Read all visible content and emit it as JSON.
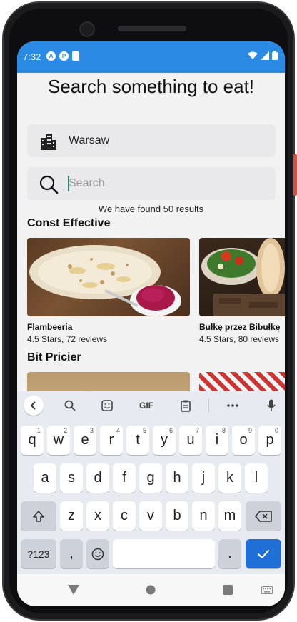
{
  "status_bar": {
    "time": "7:32",
    "left_icons": [
      "A",
      "P",
      "sd-card-icon"
    ]
  },
  "app": {
    "title": "Search something to eat!",
    "city": "Warsaw",
    "search": {
      "placeholder": "Search",
      "value": ""
    },
    "result_text": "We have found 50 results"
  },
  "sections": [
    {
      "title": "Const Effective",
      "restaurants": [
        {
          "name": "Flambeeria",
          "meta": "4.5 Stars, 72 reviews"
        },
        {
          "name": "Bułkę przez Bibułkę",
          "meta": "4.5 Stars, 80 reviews"
        }
      ]
    },
    {
      "title": "Bit Pricier",
      "restaurants": [
        {
          "name": "",
          "meta": ""
        },
        {
          "name": "",
          "meta": ""
        }
      ]
    }
  ],
  "keyboard": {
    "toolbar": {
      "gif_label": "GIF"
    },
    "row1": [
      {
        "label": "q",
        "hint": "1"
      },
      {
        "label": "w",
        "hint": "2"
      },
      {
        "label": "e",
        "hint": "3"
      },
      {
        "label": "r",
        "hint": "4"
      },
      {
        "label": "t",
        "hint": "5"
      },
      {
        "label": "y",
        "hint": "6"
      },
      {
        "label": "u",
        "hint": "7"
      },
      {
        "label": "i",
        "hint": "8"
      },
      {
        "label": "o",
        "hint": "9"
      },
      {
        "label": "p",
        "hint": "0"
      }
    ],
    "row2": [
      "a",
      "s",
      "d",
      "f",
      "g",
      "h",
      "j",
      "k",
      "l"
    ],
    "row3": [
      "z",
      "x",
      "c",
      "v",
      "b",
      "n",
      "m"
    ],
    "symbols_label": "?123",
    "comma_label": ",",
    "period_label": "."
  },
  "colors": {
    "status_bar": "#2b8ae3",
    "background": "#f2f2f2",
    "field": "#e9e9eb",
    "enter_key": "#1f6fd6",
    "cursor": "#1e8e6e"
  }
}
